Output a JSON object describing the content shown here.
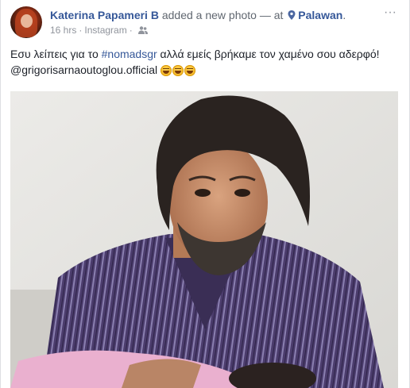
{
  "header": {
    "author_name": "Katerina Papameri B",
    "action_text": " added a new photo — at ",
    "location": "Palawan",
    "location_suffix": ".",
    "time": "16 hrs",
    "separator": "·",
    "source": "Instagram",
    "more_label": "···"
  },
  "post": {
    "text_start": "Εσυ λείπεις για το ",
    "hashtag": "#nomadsgr",
    "text_mid": " αλλά εμείς βρήκαμε τον χαμένο σου αδερφό!",
    "mention": "@grigorisarnaoutoglou.official",
    "emoji_count": 3
  },
  "icons": {
    "location": "location-pin-icon",
    "audience": "friends-audience-icon",
    "more": "more-options-icon"
  },
  "colors": {
    "link": "#365899",
    "meta": "#90949c",
    "text": "#1d2129"
  }
}
